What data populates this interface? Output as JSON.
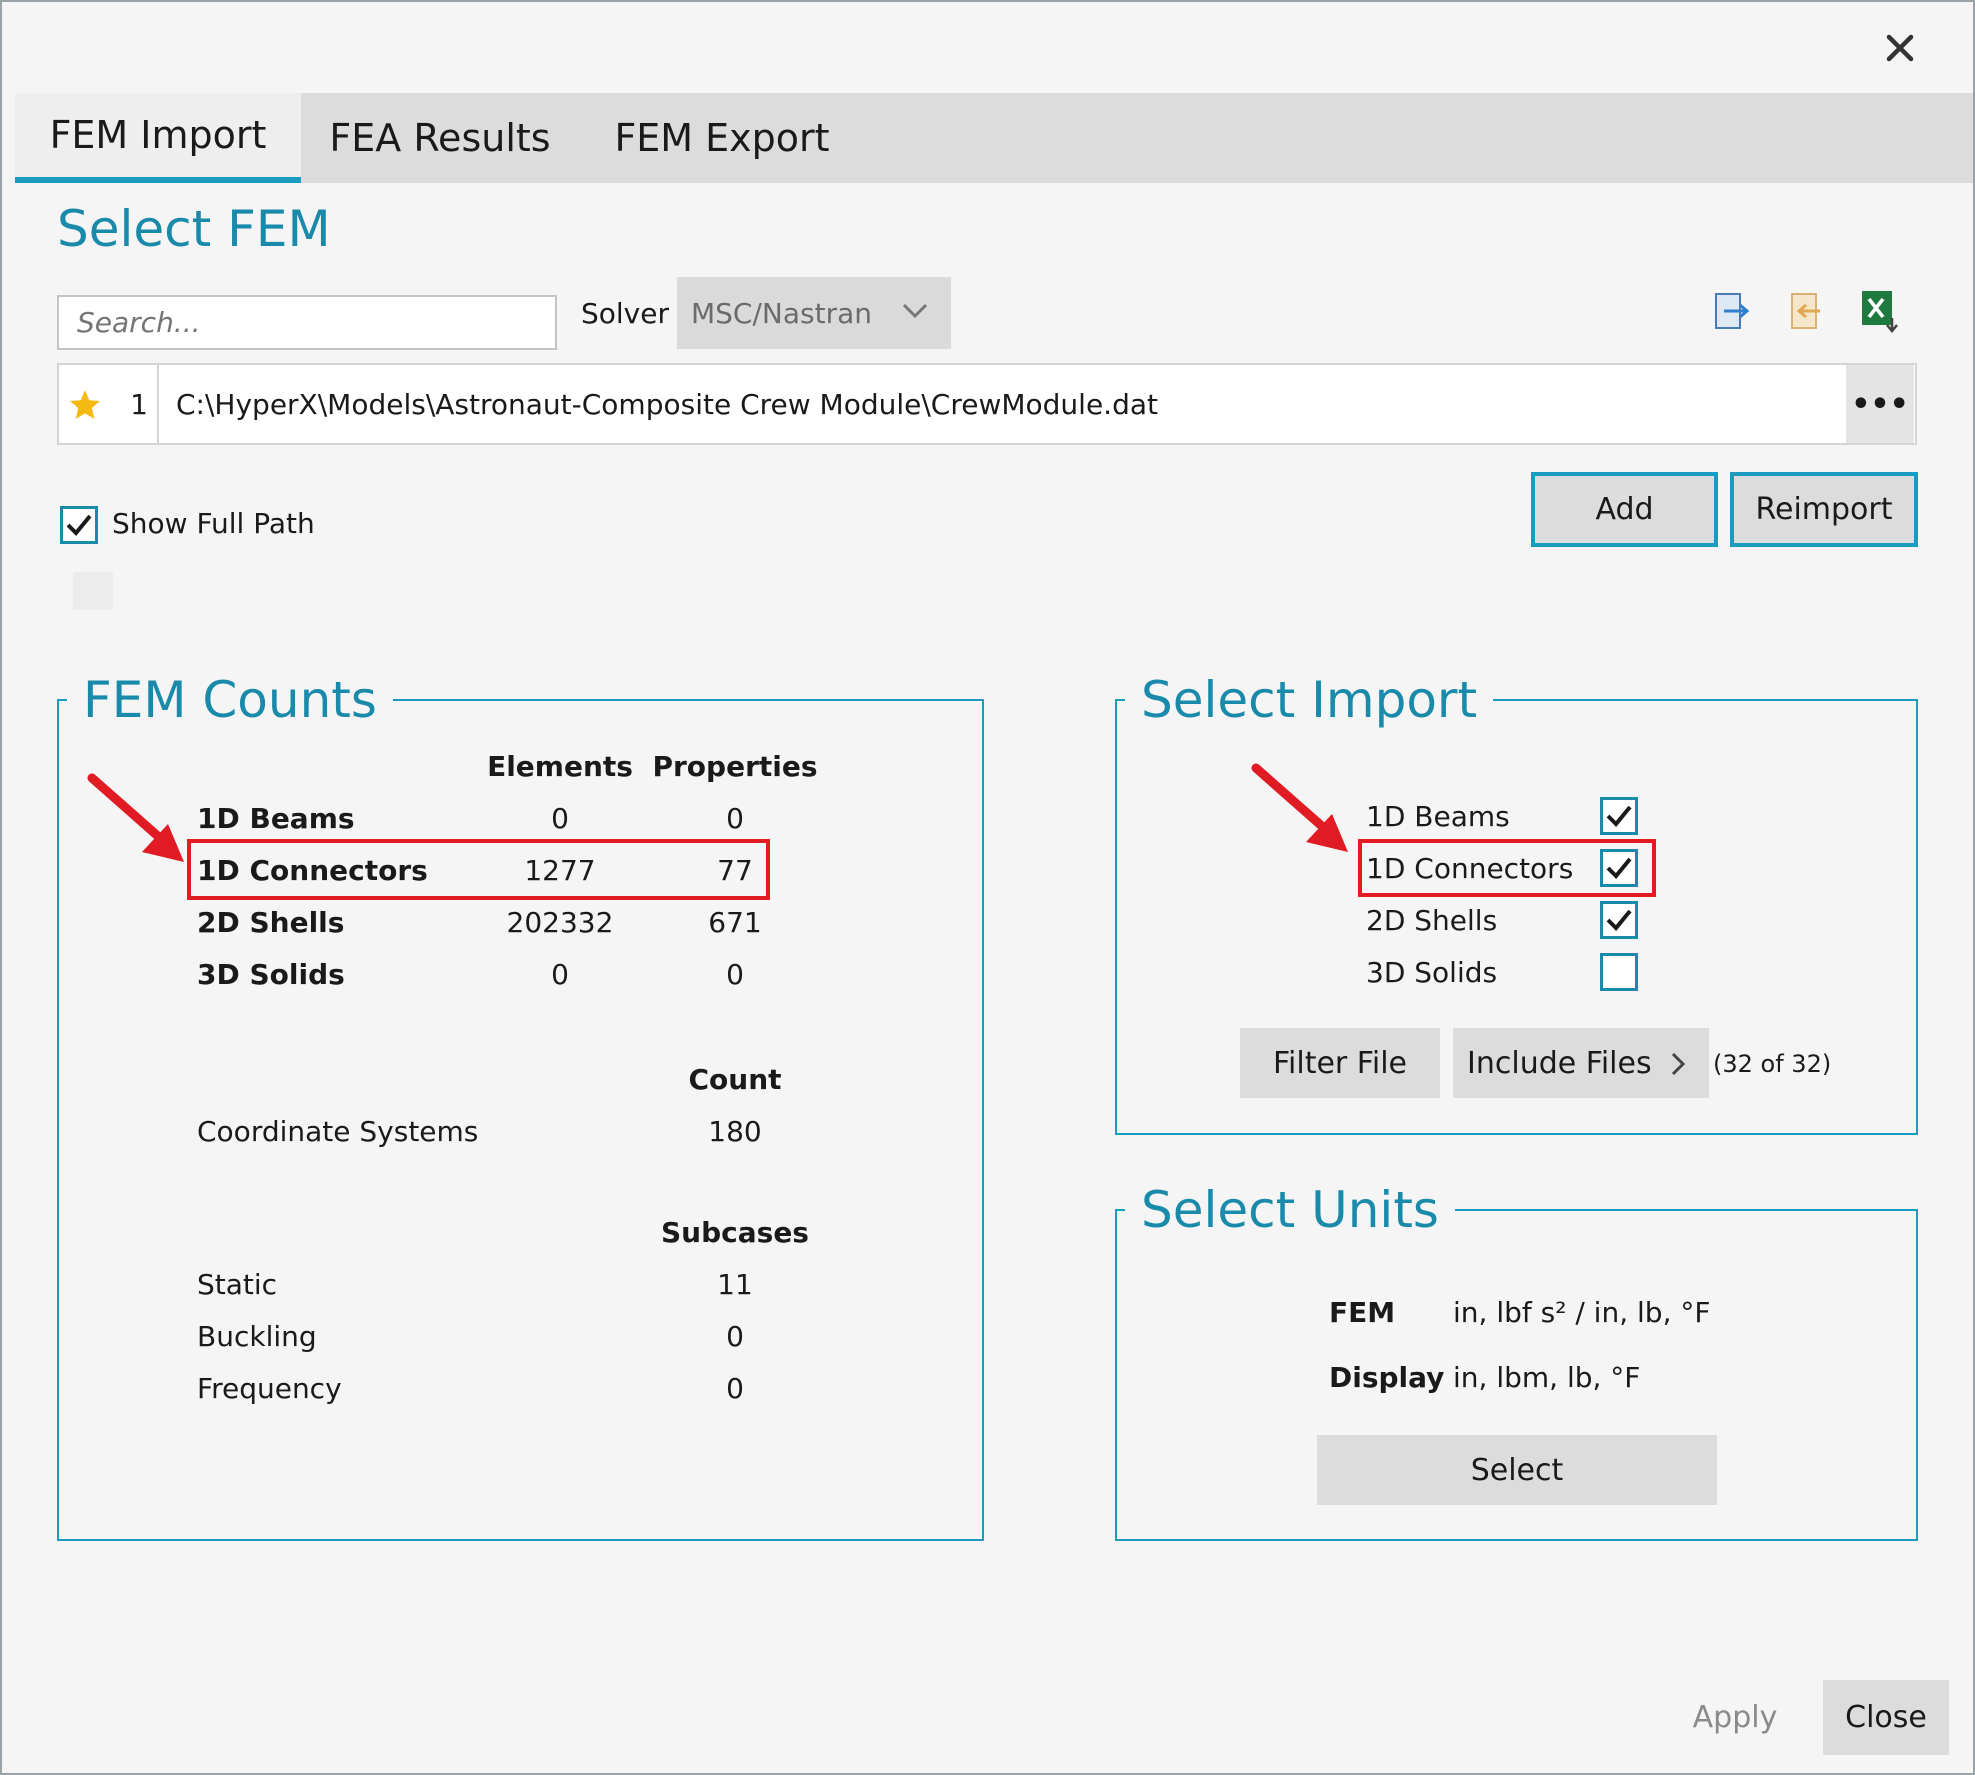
{
  "tabs": [
    {
      "label": "FEM Import",
      "active": true
    },
    {
      "label": "FEA Results",
      "active": false
    },
    {
      "label": "FEM Export",
      "active": false
    }
  ],
  "select_fem": {
    "title": "Select FEM",
    "search_placeholder": "Search...",
    "solver_label": "Solver",
    "solver_value": "MSC/Nastran",
    "file": {
      "index": "1",
      "path": "C:\\HyperX\\Models\\Astronaut-Composite Crew Module\\CrewModule.dat",
      "more": "•••"
    },
    "show_full_path_label": "Show Full Path",
    "show_full_path_checked": true,
    "add_label": "Add",
    "reimport_label": "Reimport"
  },
  "fem_counts": {
    "title": "FEM Counts",
    "col_elements": "Elements",
    "col_properties": "Properties",
    "rows": [
      {
        "label": "1D Beams",
        "elements": "0",
        "properties": "0"
      },
      {
        "label": "1D Connectors",
        "elements": "1277",
        "properties": "77"
      },
      {
        "label": "2D Shells",
        "elements": "202332",
        "properties": "671"
      },
      {
        "label": "3D Solids",
        "elements": "0",
        "properties": "0"
      }
    ],
    "count_header": "Count",
    "coord_label": "Coordinate Systems",
    "coord_count": "180",
    "subcases_header": "Subcases",
    "subcases": [
      {
        "label": "Static",
        "value": "11"
      },
      {
        "label": "Buckling",
        "value": "0"
      },
      {
        "label": "Frequency",
        "value": "0"
      }
    ]
  },
  "select_import": {
    "title": "Select Import",
    "items": [
      {
        "label": "1D Beams",
        "checked": true
      },
      {
        "label": "1D Connectors",
        "checked": true
      },
      {
        "label": "2D Shells",
        "checked": true
      },
      {
        "label": "3D Solids",
        "checked": false
      }
    ],
    "filter_file_label": "Filter File",
    "include_files_label": "Include Files",
    "include_count": "(32 of 32)"
  },
  "select_units": {
    "title": "Select Units",
    "fem_label": "FEM",
    "fem_value": "in, lbf s² / in, lb, °F",
    "display_label": "Display",
    "display_value": "in, lbm, lb, °F",
    "select_label": "Select"
  },
  "footer": {
    "apply_label": "Apply",
    "close_label": "Close"
  },
  "colors": {
    "accent": "#1a9bc0",
    "title_teal": "#1a8aaa",
    "highlight_red": "#e01b24"
  },
  "icons": [
    "close-icon",
    "chevron-down-icon",
    "export-icon",
    "import-icon",
    "excel-icon",
    "star-icon",
    "checkmark-icon",
    "chevron-right-icon",
    "arrow-annotation-icon"
  ]
}
